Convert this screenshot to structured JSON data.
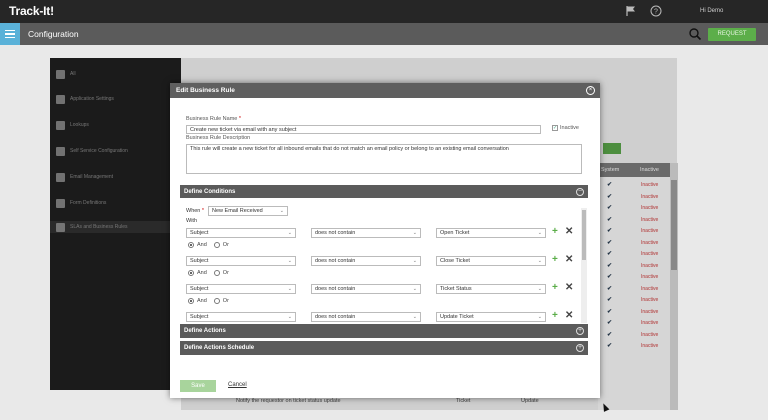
{
  "app": {
    "title": "Track-It!",
    "greeting": "Hi Demo",
    "page_title": "Configuration",
    "action_button": "REQUEST"
  },
  "background": {
    "nav_items": [
      "All",
      "Application Settings",
      "Lookups",
      "Self Service Configuration",
      "Email Management",
      "Form Definitions",
      "SLAs and Business Rules"
    ],
    "table_headers": [
      "System",
      "Inactive"
    ],
    "table_rows": [
      {
        "check": "✔",
        "status": "Inactive"
      },
      {
        "check": "✔",
        "status": "Inactive"
      },
      {
        "check": "✔",
        "status": "Inactive"
      },
      {
        "check": "✔",
        "status": "Inactive"
      },
      {
        "check": "✔",
        "status": "Inactive"
      },
      {
        "check": "✔",
        "status": "Inactive"
      },
      {
        "check": "✔",
        "status": "Inactive"
      },
      {
        "check": "✔",
        "status": "Inactive"
      },
      {
        "check": "✔",
        "status": "Inactive"
      },
      {
        "check": "✔",
        "status": "Inactive"
      },
      {
        "check": "✔",
        "status": "Inactive"
      },
      {
        "check": "✔",
        "status": "Inactive"
      },
      {
        "check": "✔",
        "status": "Inactive"
      },
      {
        "check": "✔",
        "status": "Inactive"
      },
      {
        "check": "✔",
        "status": "Inactive"
      }
    ],
    "footer_row": {
      "name": "Notify the requestor on ticket status update",
      "type": "Ticket",
      "event": "Update"
    }
  },
  "modal": {
    "title": "Edit Business Rule",
    "name_label": "Business Rule Name",
    "name_value": "Create new ticket via email with any subject",
    "inactive_label": "Inactive",
    "desc_label": "Business Rule Description",
    "desc_value": "This rule will create a new ticket for all inbound emails that do not match an email policy or belong to an existing email conversation",
    "sections": {
      "conditions": "Define Conditions",
      "actions": "Define Actions",
      "schedule": "Define Actions Schedule"
    },
    "when_label": "When",
    "when_value": "New Email Received",
    "with_label": "With",
    "conditions": [
      {
        "field": "Subject",
        "operator": "does not contain",
        "value": "Open Ticket"
      },
      {
        "field": "Subject",
        "operator": "does not contain",
        "value": "Close Ticket"
      },
      {
        "field": "Subject",
        "operator": "does not contain",
        "value": "Ticket Status"
      },
      {
        "field": "Subject",
        "operator": "does not contain",
        "value": "Update Ticket"
      }
    ],
    "and_label": "And",
    "or_label": "Or",
    "save_label": "Save",
    "cancel_label": "Cancel"
  }
}
